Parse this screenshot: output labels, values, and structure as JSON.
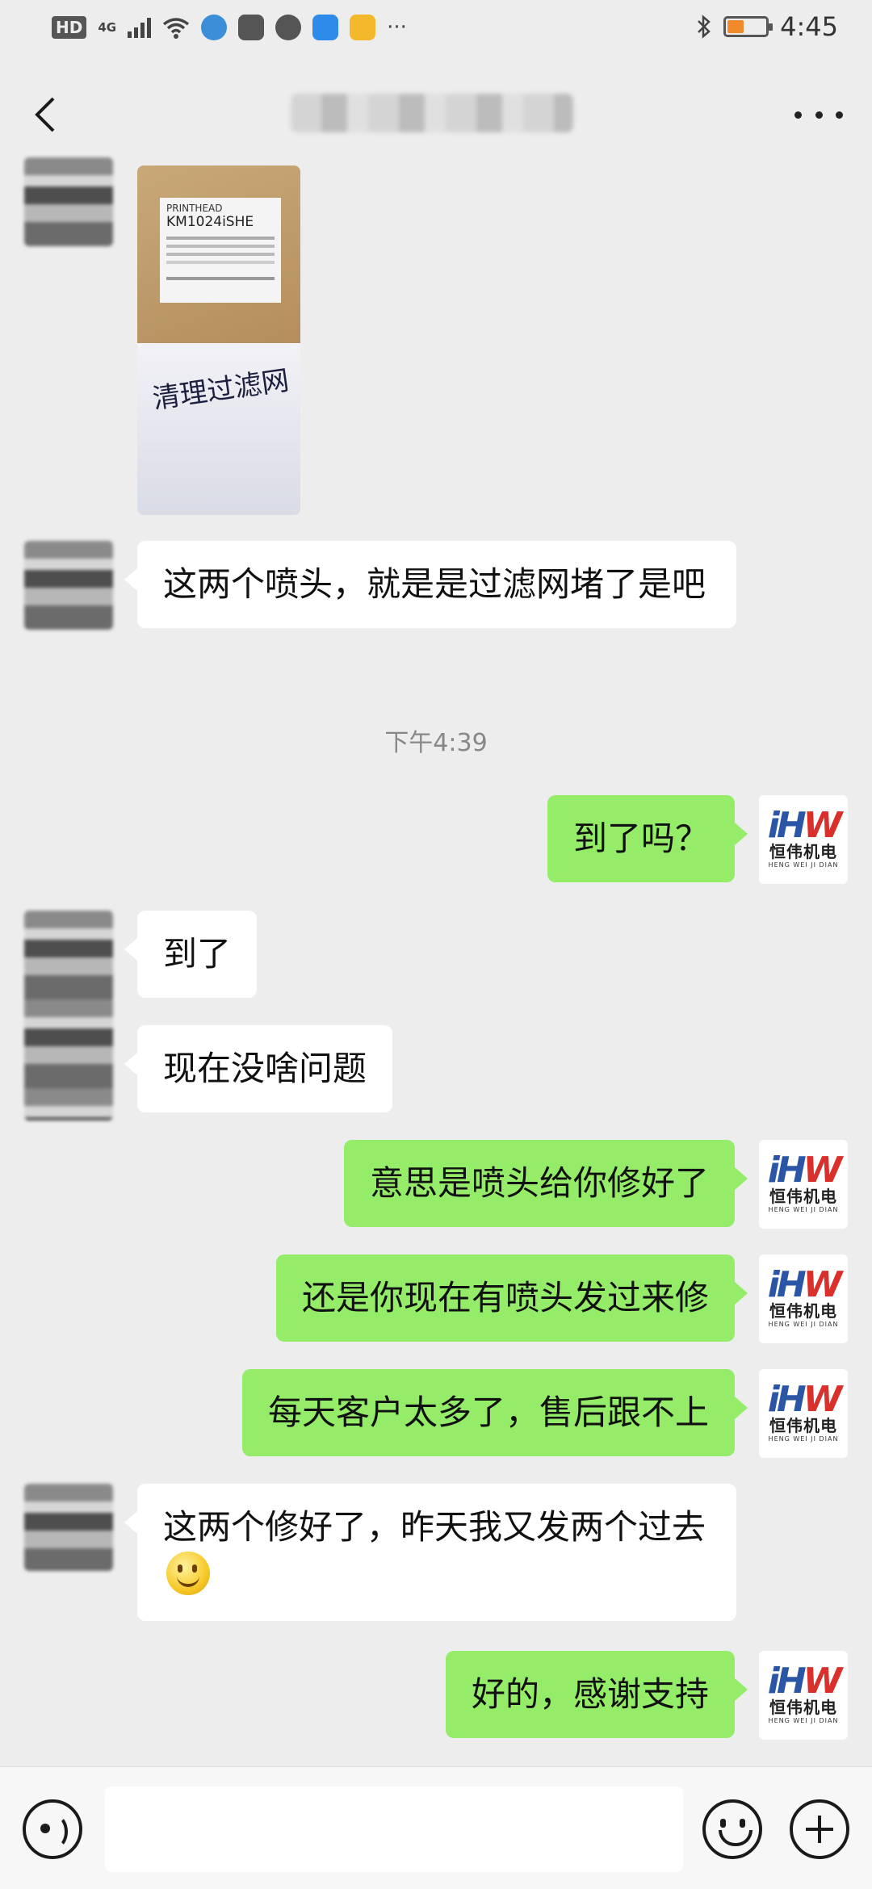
{
  "status_bar": {
    "hd_label": "HD",
    "network_label": "4G",
    "time": "4:45",
    "icons": [
      "signal-icon",
      "wifi-icon",
      "app-notification-icons",
      "more-dots-icon",
      "bluetooth-icon",
      "battery-icon"
    ],
    "battery_color": "#f08a2b"
  },
  "nav": {
    "title_pixelated": true,
    "back_icon": "chevron-left-icon",
    "more_icon": "more-dots-icon"
  },
  "photo_message": {
    "label_line1": "PRINTHEAD",
    "label_line2": "KM1024iSHE",
    "handwritten_note": "清理过滤网"
  },
  "messages": [
    {
      "side": "in",
      "text": "这两个喷头，就是是过滤网堵了是吧"
    },
    {
      "side": "out",
      "text": "到了吗？"
    },
    {
      "side": "in",
      "text": "到了"
    },
    {
      "side": "in",
      "text": "现在没啥问题"
    },
    {
      "side": "out",
      "text": "意思是喷头给你修好了"
    },
    {
      "side": "out",
      "text": "还是你现在有喷头发过来修"
    },
    {
      "side": "out",
      "text": "每天客户太多了，售后跟不上"
    },
    {
      "side": "in",
      "text": "这两个修好了，昨天我又发两个过去",
      "emoji": "smile-emoji"
    },
    {
      "side": "out",
      "text": "好的，感谢支持"
    }
  ],
  "timestamp": "下午4:39",
  "brand_avatar": {
    "logo_h": "H",
    "logo_w": "W",
    "logo_i": "i",
    "cn": "恒伟机电",
    "en": "HENG WEI JI DIAN"
  },
  "input_bar": {
    "placeholder": "",
    "voice_icon": "voice-icon",
    "emoji_icon": "emoji-icon",
    "plus_icon": "plus-icon"
  },
  "colors": {
    "background": "#ededed",
    "outgoing_bubble": "#95ec69",
    "incoming_bubble": "#ffffff"
  }
}
